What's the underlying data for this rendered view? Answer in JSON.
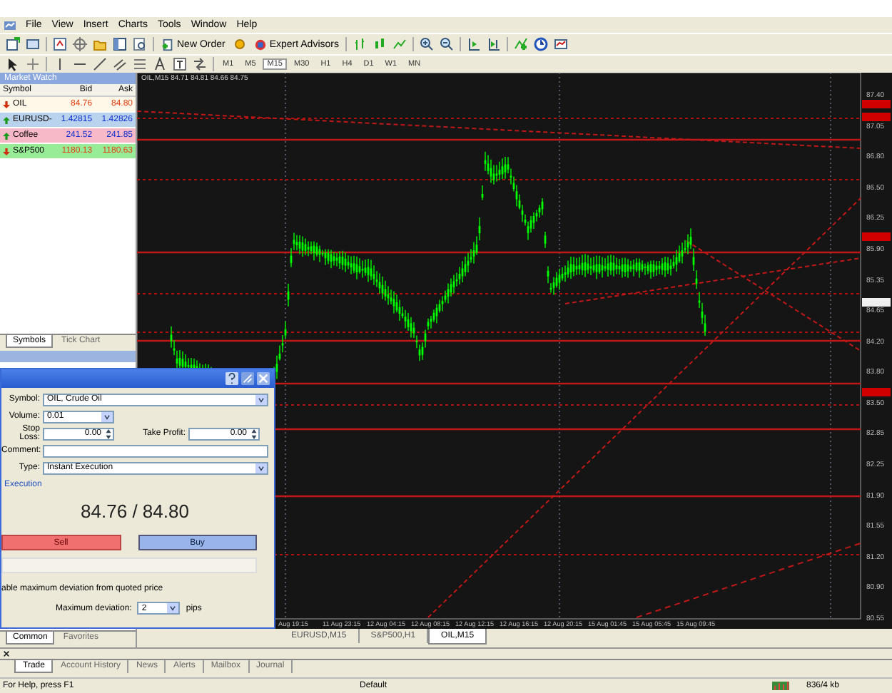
{
  "menu": [
    "File",
    "View",
    "Insert",
    "Charts",
    "Tools",
    "Window",
    "Help"
  ],
  "toolbar": {
    "buttons": [
      "New Order",
      "Expert Advisors"
    ],
    "timeframes": [
      {
        "label": "M1",
        "selected": false
      },
      {
        "label": "M5",
        "selected": false
      },
      {
        "label": "M15",
        "selected": true
      },
      {
        "label": "M30",
        "selected": false
      },
      {
        "label": "H1",
        "selected": false
      },
      {
        "label": "H4",
        "selected": false
      },
      {
        "label": "D1",
        "selected": false
      },
      {
        "label": "W1",
        "selected": false
      },
      {
        "label": "MN",
        "selected": false
      }
    ]
  },
  "market_watch": {
    "title": "Market Watch",
    "columns": [
      "Symbol",
      "Bid",
      "Ask"
    ],
    "rows": [
      {
        "symbol": "OIL",
        "bid": "84.76",
        "ask": "84.80",
        "color": "#fff8e8",
        "up": false
      },
      {
        "symbol": "EURUSD-",
        "bid": "1.42815",
        "ask": "1.42826",
        "color": "#b9d3ee",
        "up": true
      },
      {
        "symbol": "Coffee",
        "bid": "241.52",
        "ask": "241.85",
        "color": "#f7b8c8",
        "up": true
      },
      {
        "symbol": "S&P500",
        "bid": "1180.13",
        "ask": "1180.63",
        "color": "#98ec98",
        "up": false
      }
    ],
    "tabs": [
      {
        "label": "Symbols",
        "selected": true
      },
      {
        "label": "Tick Chart",
        "selected": false
      }
    ]
  },
  "navigator": {
    "tabs": [
      {
        "label": "Common",
        "selected": true
      },
      {
        "label": "Favorites",
        "selected": false
      }
    ]
  },
  "order_dialog": {
    "symbol": {
      "label": "Symbol:",
      "value": "OIL, Crude Oil"
    },
    "volume": {
      "label": "Volume:",
      "value": "0.01"
    },
    "stop_loss": {
      "label": "Stop Loss:",
      "value": "0.00"
    },
    "take_profit": {
      "label": "Take Profit:",
      "value": "0.00"
    },
    "comment": {
      "label": "Comment:"
    },
    "type": {
      "label": "Type:",
      "value": "Instant Execution"
    },
    "section": "Execution",
    "quote": "84.76 / 84.80",
    "sell": "Sell",
    "buy": "Buy",
    "deviation_note": "able maximum deviation from quoted price",
    "max_deviation": {
      "label": "Maximum deviation:",
      "value": "2",
      "unit": "pips"
    }
  },
  "chart": {
    "header": "OIL,M15  84.71 84.81 84.66 84.75",
    "price_labels": [
      "87.40",
      "87.05",
      "86.80",
      "86.50",
      "86.25",
      "85.90",
      "85.35",
      "84.65",
      "84.20",
      "83.80",
      "83.50",
      "82.85",
      "82.25",
      "81.90",
      "81.55",
      "81.20",
      "80.90",
      "80.55"
    ],
    "time_labels": [
      "Aug 19:15",
      "11 Aug 23:15",
      "12 Aug 04:15",
      "12 Aug 08:15",
      "12 Aug 12:15",
      "12 Aug 16:15",
      "12 Aug 20:15",
      "15 Aug 01:45",
      "15 Aug 05:45",
      "15 Aug 09:45"
    ]
  },
  "chart_tabs": [
    {
      "label": "EURUSD,M15",
      "selected": false
    },
    {
      "label": "S&P500,H1",
      "selected": false
    },
    {
      "label": "OIL,M15",
      "selected": true
    }
  ],
  "terminal": {
    "tabs": [
      {
        "label": "Trade",
        "selected": true
      },
      {
        "label": "Account History",
        "selected": false
      },
      {
        "label": "News",
        "selected": false
      },
      {
        "label": "Alerts",
        "selected": false
      },
      {
        "label": "Mailbox",
        "selected": false
      },
      {
        "label": "Journal",
        "selected": false
      }
    ]
  },
  "status_bar": [
    "For Help, press F1",
    "Default",
    "836/4 kb"
  ]
}
